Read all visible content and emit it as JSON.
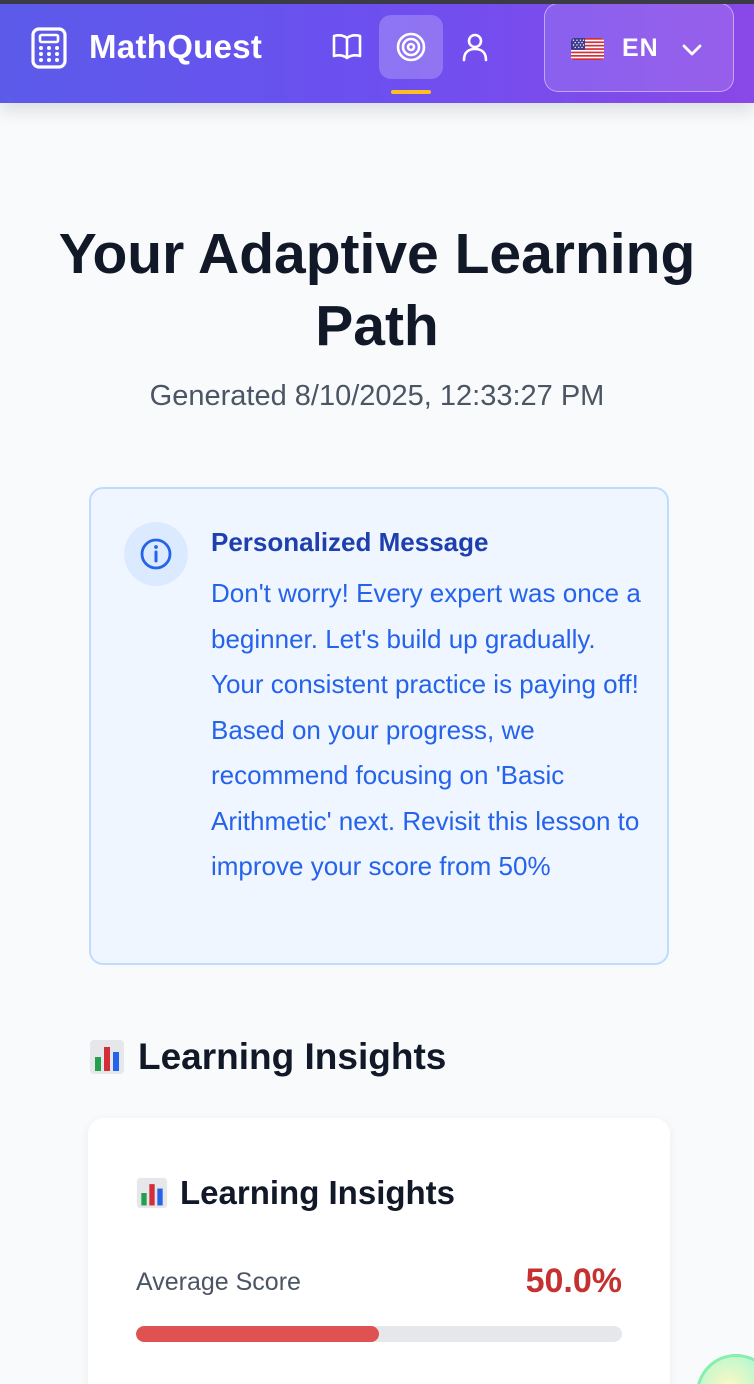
{
  "app": {
    "name": "MathQuest"
  },
  "nav": {
    "items": [
      {
        "icon": "book-open-icon",
        "active": false
      },
      {
        "icon": "target-icon",
        "active": true
      },
      {
        "icon": "user-icon",
        "active": false
      }
    ]
  },
  "language": {
    "code": "EN",
    "flag": "us-flag-icon"
  },
  "page": {
    "title": "Your Adaptive Learning Path",
    "generated": "Generated 8/10/2025, 12:33:27 PM"
  },
  "message": {
    "title": "Personalized Message",
    "body": "Don't worry! Every expert was once a beginner. Let's build up gradually. Your consistent practice is paying off! Based on your progress, we recommend focusing on 'Basic Arithmetic' next. Revisit this lesson to improve your score from 50%"
  },
  "insights": {
    "section_title": "Learning Insights",
    "card_title": "Learning Insights",
    "average_score_label": "Average Score",
    "average_score_value": "50.0%",
    "average_score_fraction": 0.5
  },
  "colors": {
    "accent": "#6d4ff0",
    "score_bad": "#c53030",
    "bar_fill": "#e05252",
    "message_text": "#2563eb"
  }
}
